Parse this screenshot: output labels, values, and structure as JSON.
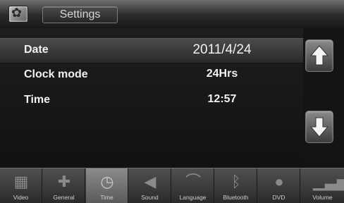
{
  "header": {
    "title": "Settings",
    "icon": "settings-app-icon"
  },
  "rows": [
    {
      "label": "Date",
      "value": "2011/4/24"
    },
    {
      "label": "Clock mode",
      "value": "24Hrs"
    },
    {
      "label": "Time",
      "value": "12:57"
    }
  ],
  "scroll": {
    "up_icon": "arrow-up-icon",
    "down_icon": "arrow-down-icon"
  },
  "tabs": [
    {
      "label": "Video",
      "icon": "video-icon"
    },
    {
      "label": "General",
      "icon": "general-icon"
    },
    {
      "label": "Time",
      "icon": "clock-icon",
      "active": true
    },
    {
      "label": "Sound",
      "icon": "speaker-icon"
    },
    {
      "label": "Language",
      "icon": "language-icon"
    },
    {
      "label": "Bluetooth",
      "icon": "bluetooth-icon"
    },
    {
      "label": "DVD",
      "icon": "disc-icon"
    },
    {
      "label": "Volume",
      "icon": "volume-icon"
    }
  ]
}
